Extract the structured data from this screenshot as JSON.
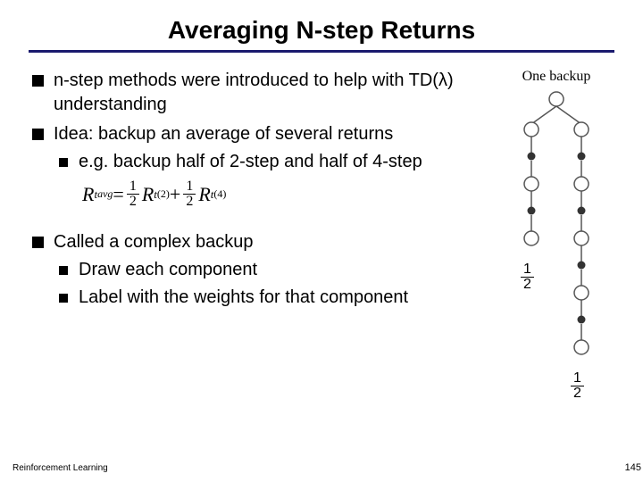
{
  "title": "Averaging N-step Returns",
  "bullets": {
    "b1": "n-step methods were introduced to help with TD(λ) understanding",
    "b2": "Idea: backup an average of several returns",
    "b2a": "e.g. backup half of 2-step and half of 4-step",
    "b3": "Called a complex backup",
    "b3a": "Draw each component",
    "b3b": "Label with the weights for that component"
  },
  "formula": {
    "lhs_sym": "R",
    "lhs_sub": "t",
    "lhs_sup": "avg",
    "eq": " = ",
    "half_num": "1",
    "half_den": "2",
    "term1_sym": "R",
    "term1_sub": "t",
    "term1_sup": "(2)",
    "plus": " + ",
    "term2_sym": "R",
    "term2_sub": "t",
    "term2_sup": "(4)"
  },
  "diagram": {
    "label": "One backup",
    "frac_num": "1",
    "frac_den": "2"
  },
  "footer": {
    "left": "Reinforcement Learning",
    "right": "145"
  }
}
